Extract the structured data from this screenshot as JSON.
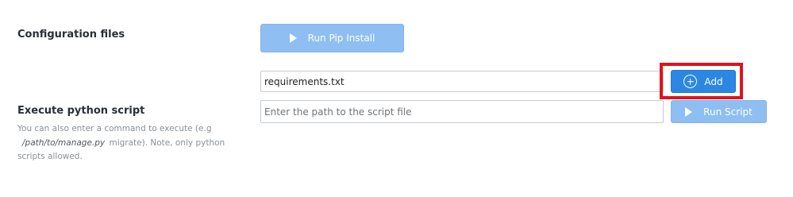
{
  "config": {
    "label": "Configuration files",
    "run_pip_label": "Run Pip Install",
    "requirements_value": "requirements.txt",
    "add_label": "Add"
  },
  "execute": {
    "label": "Execute python script",
    "help_prefix": "You can also enter a command to execute (e.g",
    "help_code": "/path/to/manage.py",
    "help_suffix": "migrate). Note, only python scripts allowed.",
    "script_placeholder": "Enter the path to the script file",
    "run_script_label": "Run Script"
  },
  "colors": {
    "primary": "#2b87e2",
    "primary_faded": "#8ebef2",
    "highlight": "#e0121c"
  },
  "icons": {
    "run_pip": "play-icon",
    "add": "plus-circle-icon",
    "run_script": "play-icon"
  }
}
